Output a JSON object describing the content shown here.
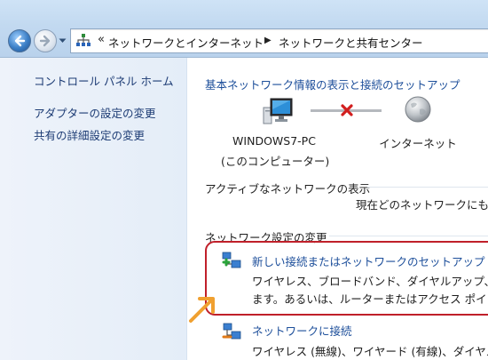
{
  "breadcrumb": {
    "overflow": "«",
    "items": [
      {
        "label": "ネットワークとインターネット"
      },
      {
        "label": "ネットワークと共有センター"
      }
    ]
  },
  "sidebar": {
    "home_label": "コントロール パネル ホーム",
    "items": [
      {
        "label": "アダプターの設定の変更"
      },
      {
        "label": "共有の詳細設定の変更"
      }
    ]
  },
  "main": {
    "title": "基本ネットワーク情報の表示と接続のセットアップ",
    "network_map": {
      "computer_name": "WINDOWS7-PC",
      "computer_sub": "(このコンピューター)",
      "internet_label": "インターネット"
    },
    "active_networks": {
      "heading": "アクティブなネットワークの表示",
      "status": "現在どのネットワークにも接"
    },
    "change_settings": {
      "heading": "ネットワーク設定の変更",
      "tasks": [
        {
          "link": "新しい接続またはネットワークのセットアップ",
          "desc_line1": "ワイヤレス、ブロードバンド、ダイヤルアップ、",
          "desc_line2": "ます。あるいは、ルーターまたはアクセス ポイン"
        },
        {
          "link": "ネットワークに接続",
          "desc_line1": "ワイヤレス (無線)、ワイヤード (有線)、ダイヤル"
        }
      ]
    }
  },
  "colors": {
    "link": "#1c4e9a",
    "highlight": "#c0202a",
    "pointer_arrow": "#f0a030"
  }
}
